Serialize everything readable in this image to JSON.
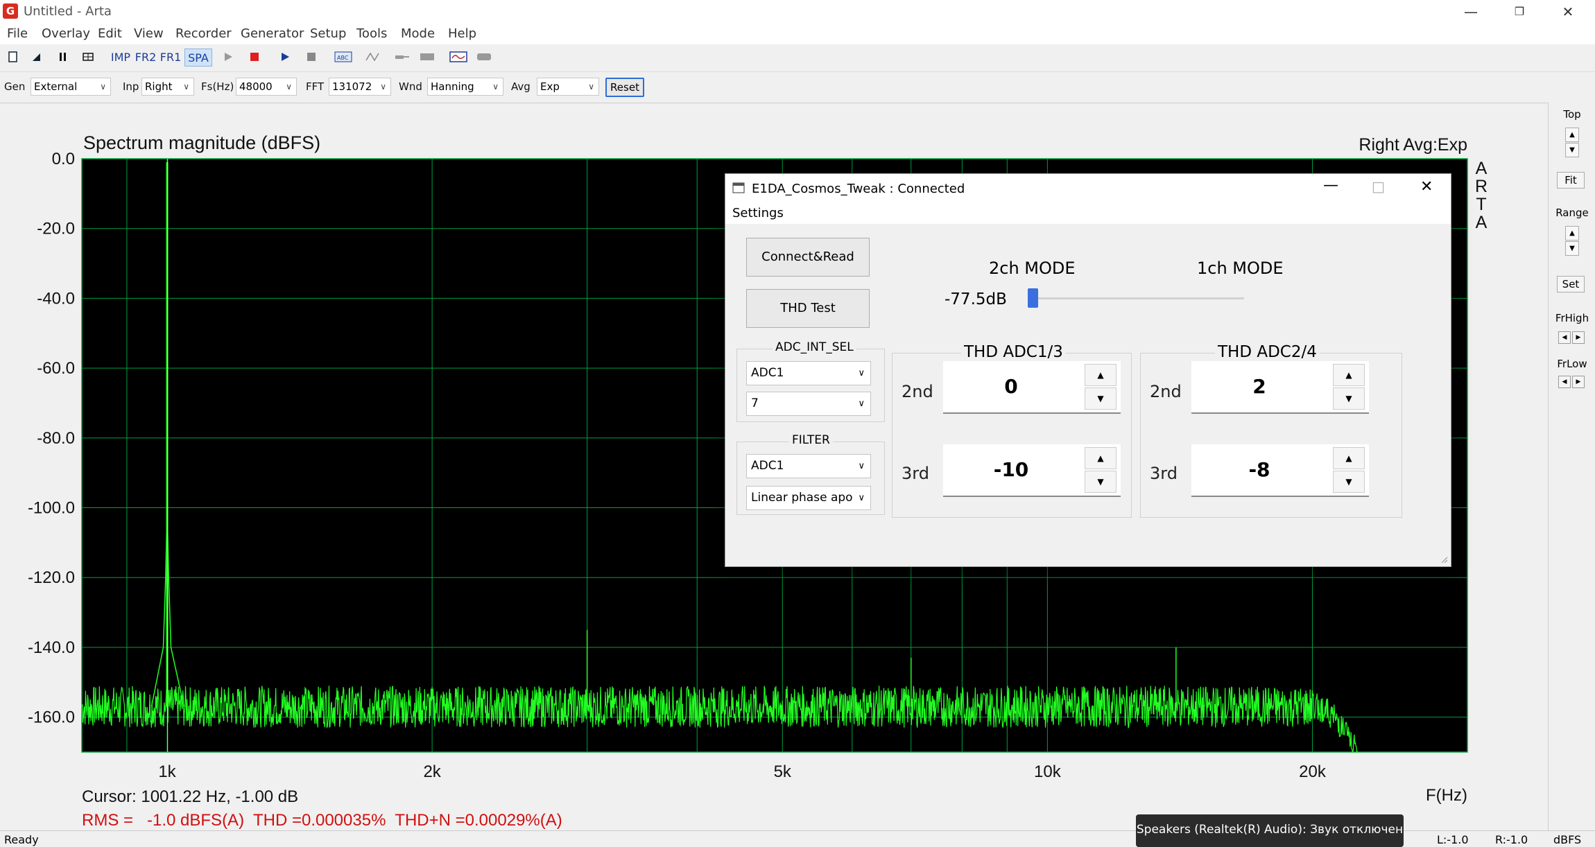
{
  "window": {
    "title": "Untitled - Arta"
  },
  "menu": [
    "File",
    "Overlay",
    "Edit",
    "View",
    "Recorder",
    "Generator",
    "Setup",
    "Tools",
    "Mode",
    "Help"
  ],
  "toolbar": {
    "imp": "IMP",
    "fr2": "FR2",
    "fr1": "FR1",
    "spa": "SPA"
  },
  "options": {
    "gen_label": "Gen",
    "gen_value": "External",
    "inp_label": "Inp",
    "inp_value": "Right",
    "fs_label": "Fs(Hz)",
    "fs_value": "48000",
    "fft_label": "FFT",
    "fft_value": "131072",
    "wnd_label": "Wnd",
    "wnd_value": "Hanning",
    "avg_label": "Avg",
    "avg_value": "Exp",
    "reset_label": "Reset"
  },
  "chart_data": {
    "type": "line",
    "title": "Spectrum magnitude (dBFS)",
    "corner_label": "Right Avg:Exp",
    "watermark": "ARTA",
    "xlabel": "F(Hz)",
    "ylabel": "",
    "x_scale": "log",
    "xlim": [
      800,
      30000
    ],
    "ylim": [
      -170,
      0
    ],
    "yticks": [
      "0.0",
      "-20.0",
      "-40.0",
      "-60.0",
      "-80.0",
      "-100.0",
      "-120.0",
      "-140.0",
      "-160.0"
    ],
    "ytick_values": [
      0,
      -20,
      -40,
      -60,
      -80,
      -100,
      -120,
      -140,
      -160
    ],
    "xticks": [
      "1k",
      "2k",
      "5k",
      "10k",
      "20k"
    ],
    "xtick_values": [
      1000,
      2000,
      5000,
      10000,
      20000
    ],
    "grid": true,
    "background": "#000000",
    "grid_color": "#00a040",
    "trace_color": "#22ff22",
    "series": [
      {
        "name": "",
        "points": [
          [
            1000,
            -1
          ],
          [
            2000,
            -157
          ],
          [
            3000,
            -135
          ],
          [
            5000,
            -157
          ],
          [
            7000,
            -143
          ],
          [
            10000,
            -157
          ],
          [
            14000,
            -140
          ],
          [
            20000,
            -157
          ],
          [
            22000,
            -170
          ],
          [
            24000,
            -170
          ]
        ]
      }
    ],
    "noise_floor": -157,
    "cursor_x": 1001.22
  },
  "readout": {
    "cursor": "Cursor: 1001.22 Hz, -1.00 dB",
    "rms": "RMS =   -1.0 dBFS(A)  THD =0.000035%  THD+N =0.00029%(A)"
  },
  "right_panel": {
    "top": "Top",
    "fit": "Fit",
    "range": "Range",
    "set": "Set",
    "frhigh": "FrHigh",
    "frlow": "FrLow"
  },
  "status": {
    "left": "Ready",
    "l": "L:-1.0",
    "r": "R:-1.0",
    "unit": "dBFS"
  },
  "dialog": {
    "title": "E1DA_Cosmos_Tweak : Connected",
    "menu": "Settings",
    "connect": "Connect&Read",
    "thd_test": "THD Test",
    "mode_2ch": "2ch MODE",
    "mode_1ch": "1ch MODE",
    "level": "-77.5dB",
    "adc_int_sel": "ADC_INT_SEL",
    "adc_sel_value": "ADC1",
    "adc_sel_num": "7",
    "filter": "FILTER",
    "filter_adc": "ADC1",
    "filter_type": "Linear phase apo",
    "thd13": "THD ADC1/3",
    "thd24": "THD ADC2/4",
    "lbl_2nd": "2nd",
    "lbl_3rd": "3rd",
    "adc13_2nd": "0",
    "adc13_3rd": "-10",
    "adc24_2nd": "2",
    "adc24_3rd": "-8"
  },
  "toast": "Speakers (Realtek(R) Audio): Звук отключен"
}
